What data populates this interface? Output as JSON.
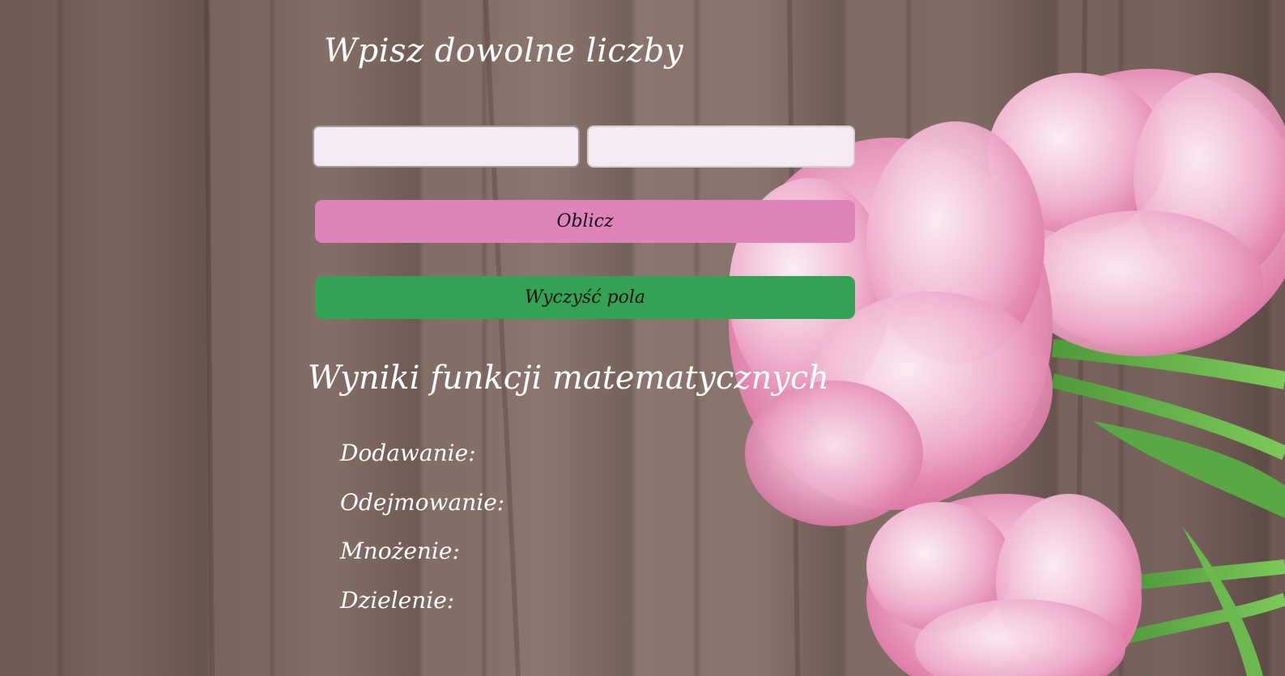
{
  "heading": "Wpisz dowolne liczby",
  "inputs": {
    "first": {
      "value": "",
      "placeholder": ""
    },
    "second": {
      "value": "",
      "placeholder": ""
    }
  },
  "buttons": {
    "calculate": "Oblicz",
    "clear": "Wyczyść pola"
  },
  "results": {
    "title": "Wyniki funkcji matematycznych",
    "addition": {
      "label": "Dodawanie:",
      "value": ""
    },
    "subtraction": {
      "label": "Odejmowanie:",
      "value": ""
    },
    "multiplication": {
      "label": "Mnożenie:",
      "value": ""
    },
    "division": {
      "label": "Dzielenie:",
      "value": ""
    }
  },
  "colors": {
    "calculate_button": "#df83bb",
    "clear_button": "#33a353",
    "input_background": "#f5eaf3",
    "text": "#ffffff"
  },
  "background": "wooden planks with pink tulips"
}
